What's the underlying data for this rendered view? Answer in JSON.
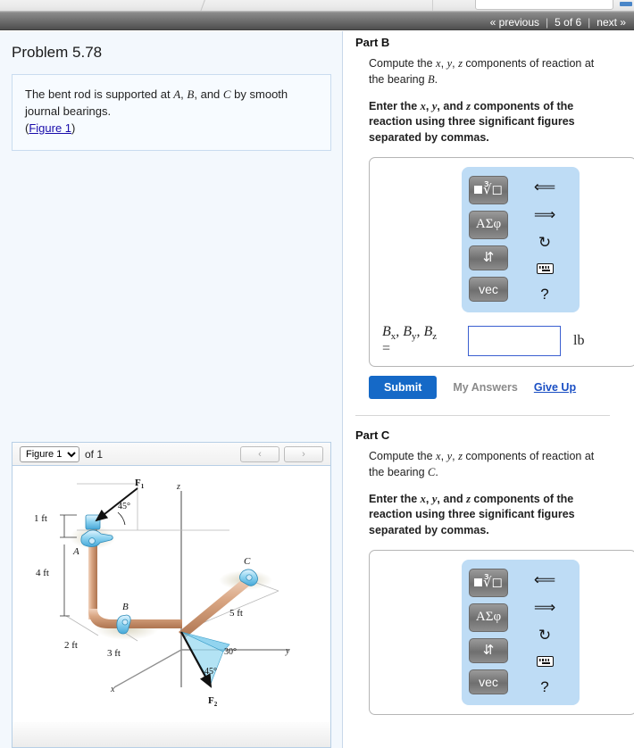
{
  "nav": {
    "previous": "« previous",
    "separator": "|",
    "counter": "5 of 6",
    "next": "next »"
  },
  "left": {
    "problem_title": "Problem 5.78",
    "statement_line1": "The bent rod is supported at ",
    "statement_a": "A",
    "statement_comma1": ", ",
    "statement_b": "B",
    "statement_and": ", and ",
    "statement_c": "C",
    "statement_line2": " by smooth journal bearings.",
    "figure_link_open": "(",
    "figure_link": "Figure 1",
    "figure_link_close": ")"
  },
  "figure_panel": {
    "select_value": "Figure 1",
    "of_label": "of 1",
    "prev_button": "‹",
    "next_button": "›"
  },
  "figure": {
    "title": "Bent rod supported by journal bearings at A, B, C",
    "axis_x": "x",
    "axis_y": "y",
    "axis_z": "z",
    "bearing_a": "A",
    "bearing_b": "B",
    "bearing_c": "C",
    "force_1": "F",
    "force_1_sub": "1",
    "force_2": "F",
    "force_2_sub": "2",
    "dim_1ft": "1 ft",
    "dim_4ft": "4 ft",
    "dim_2ft": "2 ft",
    "dim_3ft": "3 ft",
    "dim_5ft": "5 ft",
    "angle_45_top": "45°",
    "angle_30": "30°",
    "angle_45_bottom": "45°"
  },
  "palette": {
    "template_button": "template-fraction-radical",
    "greek_button": "ΑΣφ",
    "arrows_button": "⇵",
    "vec_button": "vec",
    "undo_icon": "↰",
    "redo_icon": "↱",
    "reset_icon": "↻",
    "keyboard_icon": "keyboard",
    "help_icon": "?"
  },
  "partB": {
    "heading": "Part B",
    "prompt_pre": "Compute the ",
    "prompt_x": "x",
    "prompt_c1": ", ",
    "prompt_y": "y",
    "prompt_c2": ", ",
    "prompt_z": "z",
    "prompt_post": " components of reaction at the bearing ",
    "prompt_bearing": "B",
    "prompt_end": ".",
    "instruction_pre": "Enter the ",
    "instruction_x": "x",
    "instruction_c1": ", ",
    "instruction_y": "y",
    "instruction_c2": ", and ",
    "instruction_z": "z",
    "instruction_post": " components of the reaction using three significant figures separated by commas.",
    "answer_label_1": "B",
    "answer_sub_1": "x",
    "answer_label_2": "B",
    "answer_sub_2": "y",
    "answer_label_3": "B",
    "answer_sub_3": "z",
    "answer_equals": "=",
    "answer_value": "",
    "answer_unit": "lb",
    "submit_label": "Submit",
    "my_answers_label": "My Answers",
    "give_up_label": "Give Up"
  },
  "partC": {
    "heading": "Part C",
    "prompt_pre": "Compute the ",
    "prompt_x": "x",
    "prompt_c1": ", ",
    "prompt_y": "y",
    "prompt_c2": ", ",
    "prompt_z": "z",
    "prompt_post": " components of reaction at the bearing ",
    "prompt_bearing": "C",
    "prompt_end": ".",
    "instruction_pre": "Enter the ",
    "instruction_x": "x",
    "instruction_c1": ", ",
    "instruction_y": "y",
    "instruction_c2": ", and ",
    "instruction_z": "z",
    "instruction_post": " components of the reaction using three significant figures separated by commas."
  },
  "colors": {
    "accent_blue": "#1569c7",
    "link_blue": "#1a4fc4",
    "palette_blue": "#bedcf5",
    "panel_bg": "#f3f8fd",
    "navbar_gray": "#6e6e6e"
  }
}
